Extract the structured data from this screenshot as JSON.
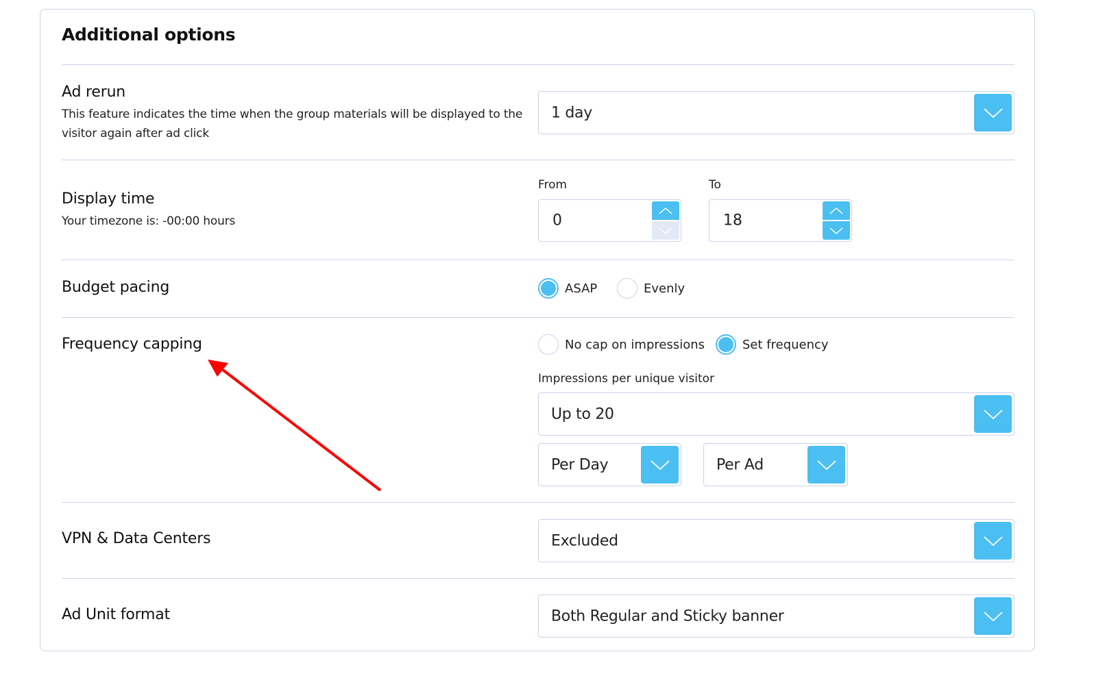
{
  "section_title": "Additional options",
  "accent_color": "#4bbff2",
  "annotation_color": "#ff0000",
  "ad_rerun": {
    "label": "Ad rerun",
    "description": "This feature indicates the time when the group materials will be displayed to the visitor again after ad click",
    "selected": "1 day"
  },
  "display_time": {
    "label": "Display time",
    "timezone_text": "Your timezone is: -00:00 hours",
    "from_label": "From",
    "from_value": "0",
    "to_label": "To",
    "to_value": "18"
  },
  "budget_pacing": {
    "label": "Budget pacing",
    "options": [
      {
        "label": "ASAP",
        "checked": true
      },
      {
        "label": "Evenly",
        "checked": false
      }
    ]
  },
  "frequency_capping": {
    "label": "Frequency capping",
    "options": [
      {
        "label": "No cap on impressions",
        "checked": false
      },
      {
        "label": "Set frequency",
        "checked": true
      }
    ],
    "impressions_label": "Impressions per unique visitor",
    "impressions_selected": "Up to 20",
    "period_selected": "Per Day",
    "scope_selected": "Per Ad"
  },
  "vpn": {
    "label": "VPN & Data Centers",
    "selected": "Excluded"
  },
  "ad_unit_format": {
    "label": "Ad Unit format",
    "selected": "Both Regular and Sticky banner"
  }
}
